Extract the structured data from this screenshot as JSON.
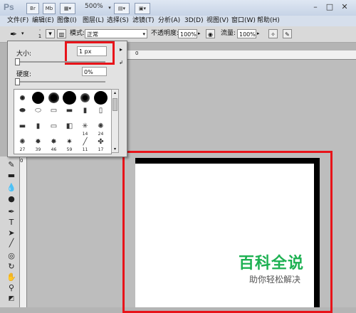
{
  "app": {
    "logo_text": "Ps",
    "zoom": "500%",
    "toolbar_icons": [
      "bridge-icon",
      "minibridge-icon",
      "view-extras-icon",
      "zoom-dropdown",
      "arrange-icon",
      "screen-mode-icon"
    ],
    "window_controls": [
      "minimize-icon",
      "maximize-icon",
      "close-icon"
    ]
  },
  "menu": [
    "文件(F)",
    "编辑(E)",
    "图像(I)",
    "图层(L)",
    "选择(S)",
    "滤镜(T)",
    "分析(A)",
    "3D(D)",
    "视图(V)",
    "窗口(W)",
    "帮助(H)"
  ],
  "options_bar": {
    "brush_size_small": "1",
    "mode_label": "模式:",
    "mode_value": "正常",
    "opacity_label": "不透明度:",
    "opacity_value": "100%",
    "flow_label": "流量:",
    "flow_value": "100%"
  },
  "brush_panel": {
    "size_label": "大小:",
    "size_value": "1 px",
    "hardness_label": "硬度:",
    "hardness_value": "0%",
    "size_slider_level": 0,
    "hardness_slider_level": 0,
    "preset_numbers": [
      "14",
      "24",
      "27",
      "39",
      "46",
      "59",
      "11",
      "17"
    ]
  },
  "ruler": {
    "h_zero": "0",
    "v_zero": "0"
  },
  "watermark": {
    "title": "百科全说",
    "subtitle": "助你轻松解决"
  },
  "colors": {
    "highlight_red": "#e8141a",
    "watermark_green": "#1db152"
  }
}
